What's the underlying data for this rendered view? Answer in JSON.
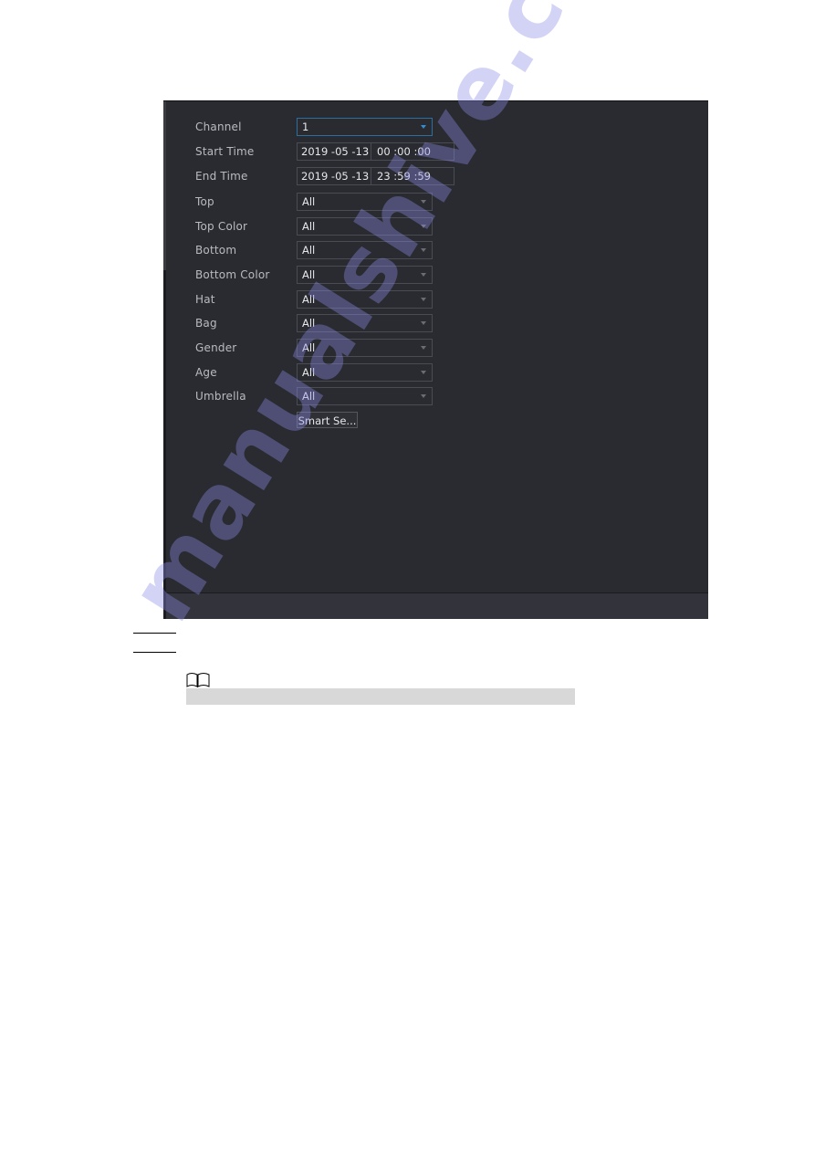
{
  "form": {
    "channel": {
      "label": "Channel",
      "value": "1"
    },
    "start_time": {
      "label": "Start Time",
      "date": "2019 -05 -13",
      "time": "00 :00 :00"
    },
    "end_time": {
      "label": "End Time",
      "date": "2019 -05 -13",
      "time": "23 :59 :59"
    },
    "filters": [
      {
        "label": "Top",
        "value": "All"
      },
      {
        "label": "Top Color",
        "value": "All"
      },
      {
        "label": "Bottom",
        "value": "All"
      },
      {
        "label": "Bottom Color",
        "value": "All"
      },
      {
        "label": "Hat",
        "value": "All"
      },
      {
        "label": "Bag",
        "value": "All"
      },
      {
        "label": "Gender",
        "value": "All"
      },
      {
        "label": "Age",
        "value": "All"
      },
      {
        "label": "Umbrella",
        "value": "All"
      }
    ],
    "smart_search_button": "Smart Se..."
  },
  "watermark": "manualshive.com",
  "colors": {
    "panel_bg": "#2a2b31",
    "accent_blue": "#2e8fd6",
    "label_text": "#b9bbc1",
    "value_text": "#e6e7ea",
    "note_bar": "#d8d8d8"
  }
}
